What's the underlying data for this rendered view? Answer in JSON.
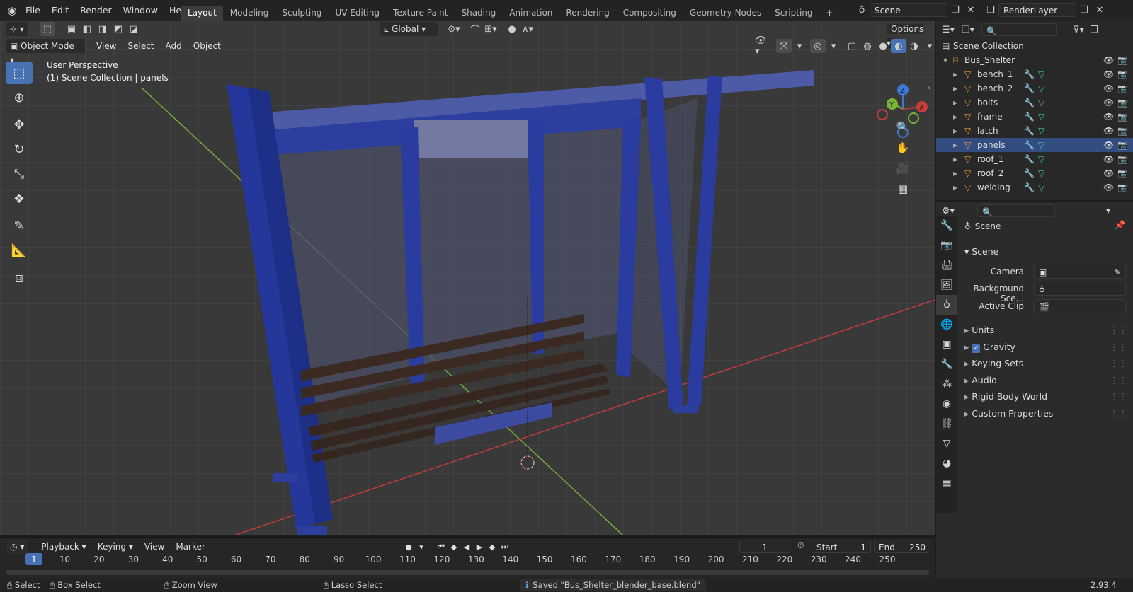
{
  "topbar": {
    "menus": [
      "File",
      "Edit",
      "Render",
      "Window",
      "Help"
    ],
    "workspaces": [
      "Layout",
      "Modeling",
      "Sculpting",
      "UV Editing",
      "Texture Paint",
      "Shading",
      "Animation",
      "Rendering",
      "Compositing",
      "Geometry Nodes",
      "Scripting"
    ],
    "active_workspace": "Layout",
    "scene_name": "Scene",
    "view_layer": "RenderLayer"
  },
  "viewport": {
    "mode": "Object Mode",
    "menus": [
      "View",
      "Select",
      "Add",
      "Object"
    ],
    "transform_orientation": "Global",
    "options_label": "Options",
    "info_line1": "User Perspective",
    "info_line2": "(1) Scene Collection | panels",
    "axes": {
      "x": "X",
      "y": "Y",
      "z": "Z"
    }
  },
  "outliner": {
    "root": "Scene Collection",
    "collection": "Bus_Shelter",
    "objects": [
      "bench_1",
      "bench_2",
      "bolts",
      "frame",
      "latch",
      "panels",
      "roof_1",
      "roof_2",
      "welding"
    ],
    "selected": "panels"
  },
  "properties": {
    "context": "Scene",
    "panel_title": "Scene",
    "fields": {
      "camera_label": "Camera",
      "background_label": "Background Sce...",
      "active_clip_label": "Active Clip"
    },
    "subpanels": [
      "Units",
      "Gravity",
      "Keying Sets",
      "Audio",
      "Rigid Body World",
      "Custom Properties"
    ],
    "gravity_checked": true
  },
  "timeline": {
    "menus": [
      "Playback",
      "Keying",
      "View",
      "Marker"
    ],
    "current_frame": "1",
    "start_label": "Start",
    "start": "1",
    "end_label": "End",
    "end": "250",
    "ticks": [
      "1",
      "10",
      "20",
      "30",
      "40",
      "50",
      "60",
      "70",
      "80",
      "90",
      "100",
      "110",
      "120",
      "130",
      "140",
      "150",
      "160",
      "170",
      "180",
      "190",
      "200",
      "210",
      "220",
      "230",
      "240",
      "250"
    ]
  },
  "statusbar": {
    "select": "Select",
    "box_select": "Box Select",
    "zoom_view": "Zoom View",
    "lasso_select": "Lasso Select",
    "message": "Saved \"Bus_Shelter_blender_base.blend\"",
    "version": "2.93.4"
  },
  "colors": {
    "accent": "#4772b3",
    "shelter_blue": "#2c3f9e",
    "bench": "#3a2a22",
    "x_axis": "#c83c3c",
    "y_axis": "#7ab33c",
    "z_axis": "#3c78d8"
  }
}
